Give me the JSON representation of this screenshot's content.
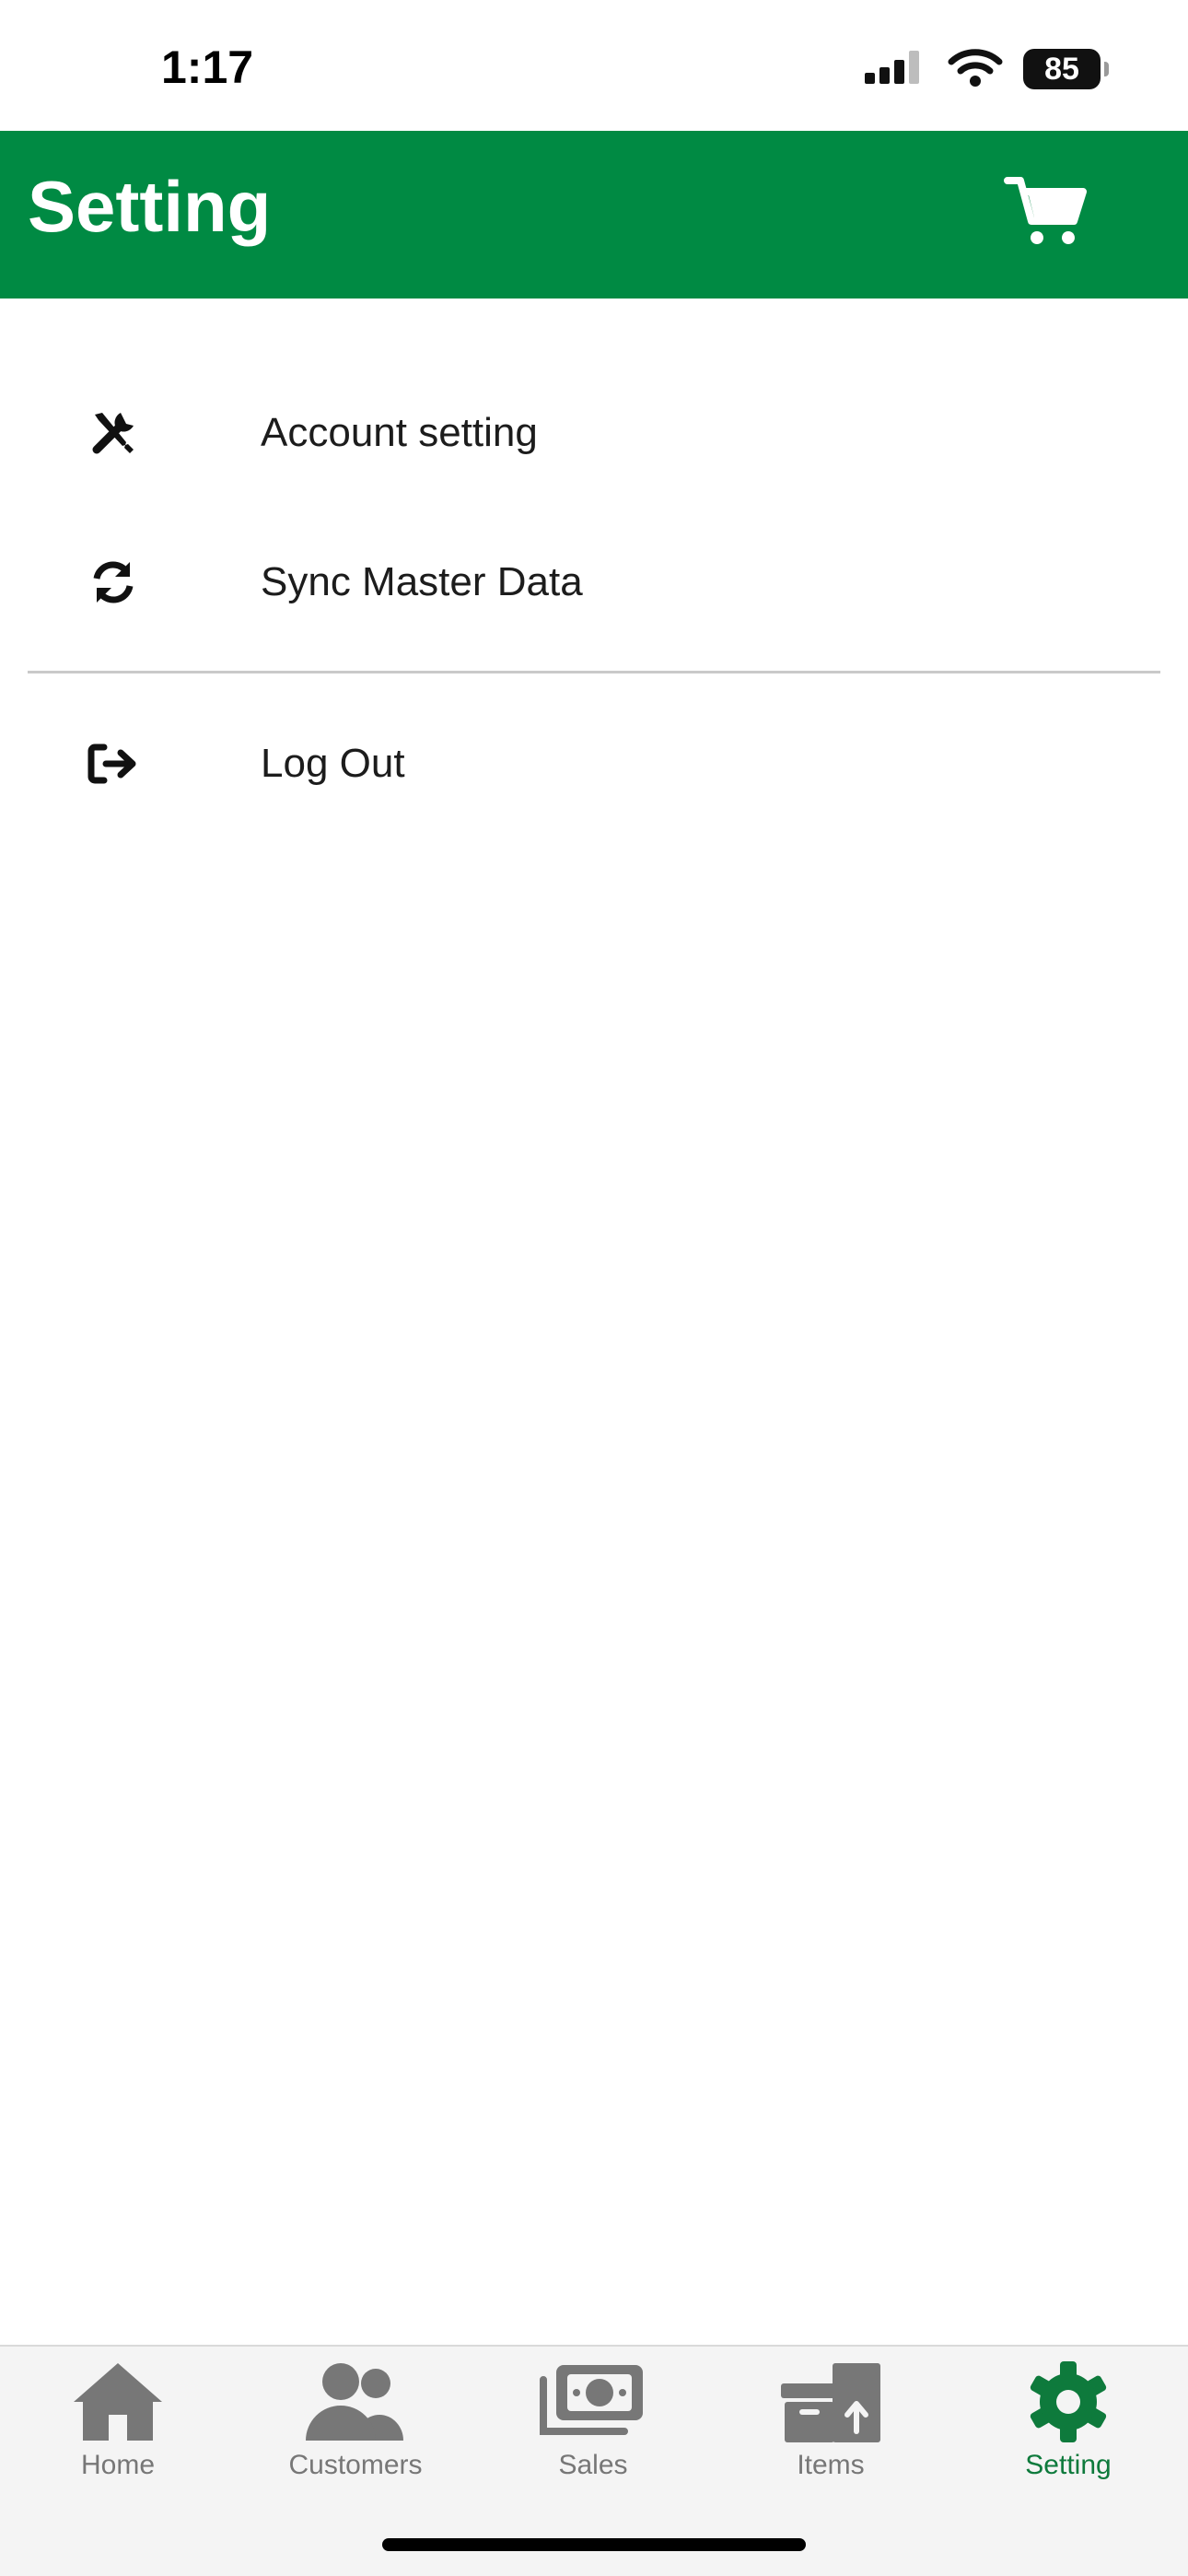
{
  "status_bar": {
    "time": "1:17",
    "battery_level": "85",
    "icons": [
      "signal-icon",
      "wifi-icon",
      "battery-icon"
    ]
  },
  "header": {
    "title": "Setting",
    "cart_icon": "cart-icon",
    "background_color": "#008A43"
  },
  "menu": {
    "items": [
      {
        "label": "Account setting",
        "icon": "tools-icon"
      },
      {
        "label": "Sync Master Data",
        "icon": "sync-icon"
      },
      {
        "label": "Log Out",
        "icon": "logout-icon"
      }
    ]
  },
  "tab_bar": {
    "tabs": [
      {
        "label": "Home",
        "icon": "home-icon",
        "active": false
      },
      {
        "label": "Customers",
        "icon": "customers-icon",
        "active": false
      },
      {
        "label": "Sales",
        "icon": "money-icon",
        "active": false
      },
      {
        "label": "Items",
        "icon": "items-icon",
        "active": false
      },
      {
        "label": "Setting",
        "icon": "gear-icon",
        "active": true
      }
    ],
    "active_color": "#0E7A3C",
    "inactive_color": "#777777"
  }
}
